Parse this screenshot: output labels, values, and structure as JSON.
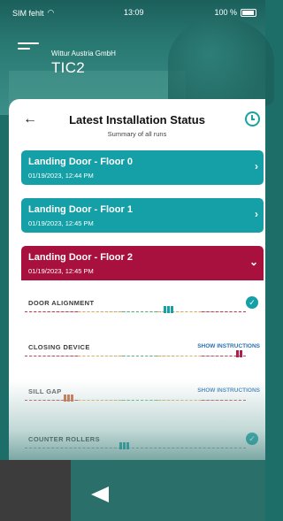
{
  "status_bar": {
    "carrier": "SIM fehlt",
    "time": "13:09",
    "battery": "100 %"
  },
  "header": {
    "company": "Wittur Austria GmbH",
    "site": "TIC2"
  },
  "sheet": {
    "title": "Latest Installation Status",
    "subtitle": "Summary of all runs"
  },
  "runs": [
    {
      "title": "Landing Door - Floor 0",
      "date": "01/19/2023, 12:44 PM",
      "color": "#14a0a6"
    },
    {
      "title": "Landing Door - Floor 1",
      "date": "01/19/2023, 12:45 PM",
      "color": "#14a0a6"
    },
    {
      "title": "Landing Door - Floor 2",
      "date": "01/19/2023, 12:45 PM",
      "color": "#a8113e"
    }
  ],
  "checks": [
    {
      "label": "DOOR ALIGNMENT",
      "status": "ok",
      "level": 0.65
    },
    {
      "label": "CLOSING DEVICE",
      "action": "SHOW INSTRUCTIONS",
      "level": 0.98
    },
    {
      "label": "SILL GAP",
      "action": "SHOW INSTRUCTIONS",
      "level": 0.2
    },
    {
      "label": "COUNTER ROLLERS",
      "status": "ok",
      "level": 0.45
    }
  ],
  "colors": {
    "accent": "#14a0a6",
    "error": "#a8113e",
    "link": "#2a6fb0"
  }
}
